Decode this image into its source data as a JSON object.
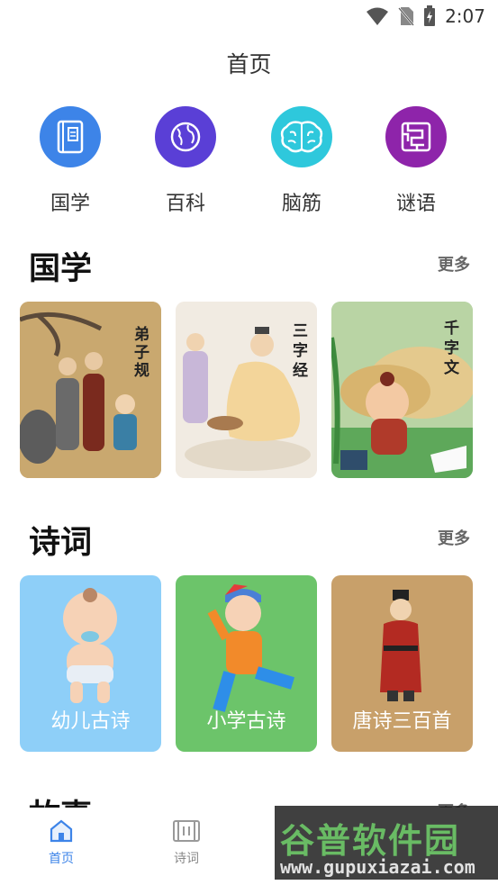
{
  "status_bar": {
    "time": "2:07"
  },
  "page": {
    "title": "首页"
  },
  "quick_nav": [
    {
      "label": "国学",
      "icon": "book-icon",
      "color": "#3d84e8"
    },
    {
      "label": "百科",
      "icon": "globe-icon",
      "color": "#5a3fd6"
    },
    {
      "label": "脑筋",
      "icon": "brain-icon",
      "color": "#2ec8dc"
    },
    {
      "label": "谜语",
      "icon": "maze-icon",
      "color": "#8e24aa"
    }
  ],
  "sections": {
    "guoxue": {
      "title": "国学",
      "more": "更多",
      "cards": [
        {
          "title": "弟子规"
        },
        {
          "title": "三字经"
        },
        {
          "title": "千字文"
        }
      ]
    },
    "shici": {
      "title": "诗词",
      "more": "更多",
      "cards": [
        {
          "title": "幼儿古诗",
          "color": "#8ecff8"
        },
        {
          "title": "小学古诗",
          "color": "#6cc46a"
        },
        {
          "title": "唐诗三百首",
          "color": "#c8a06a"
        }
      ]
    },
    "gushi": {
      "title": "故事",
      "more": "更多"
    }
  },
  "bottom_nav": [
    {
      "label": "首页",
      "icon": "home-icon",
      "active": true
    },
    {
      "label": "诗词",
      "icon": "scroll-icon",
      "active": false
    }
  ],
  "watermark": {
    "logo": "谷普软件园",
    "url": "www.gupuxiazai.com"
  },
  "colors": {
    "accent": "#3d84e8",
    "text": "#222222",
    "muted": "#666666"
  }
}
